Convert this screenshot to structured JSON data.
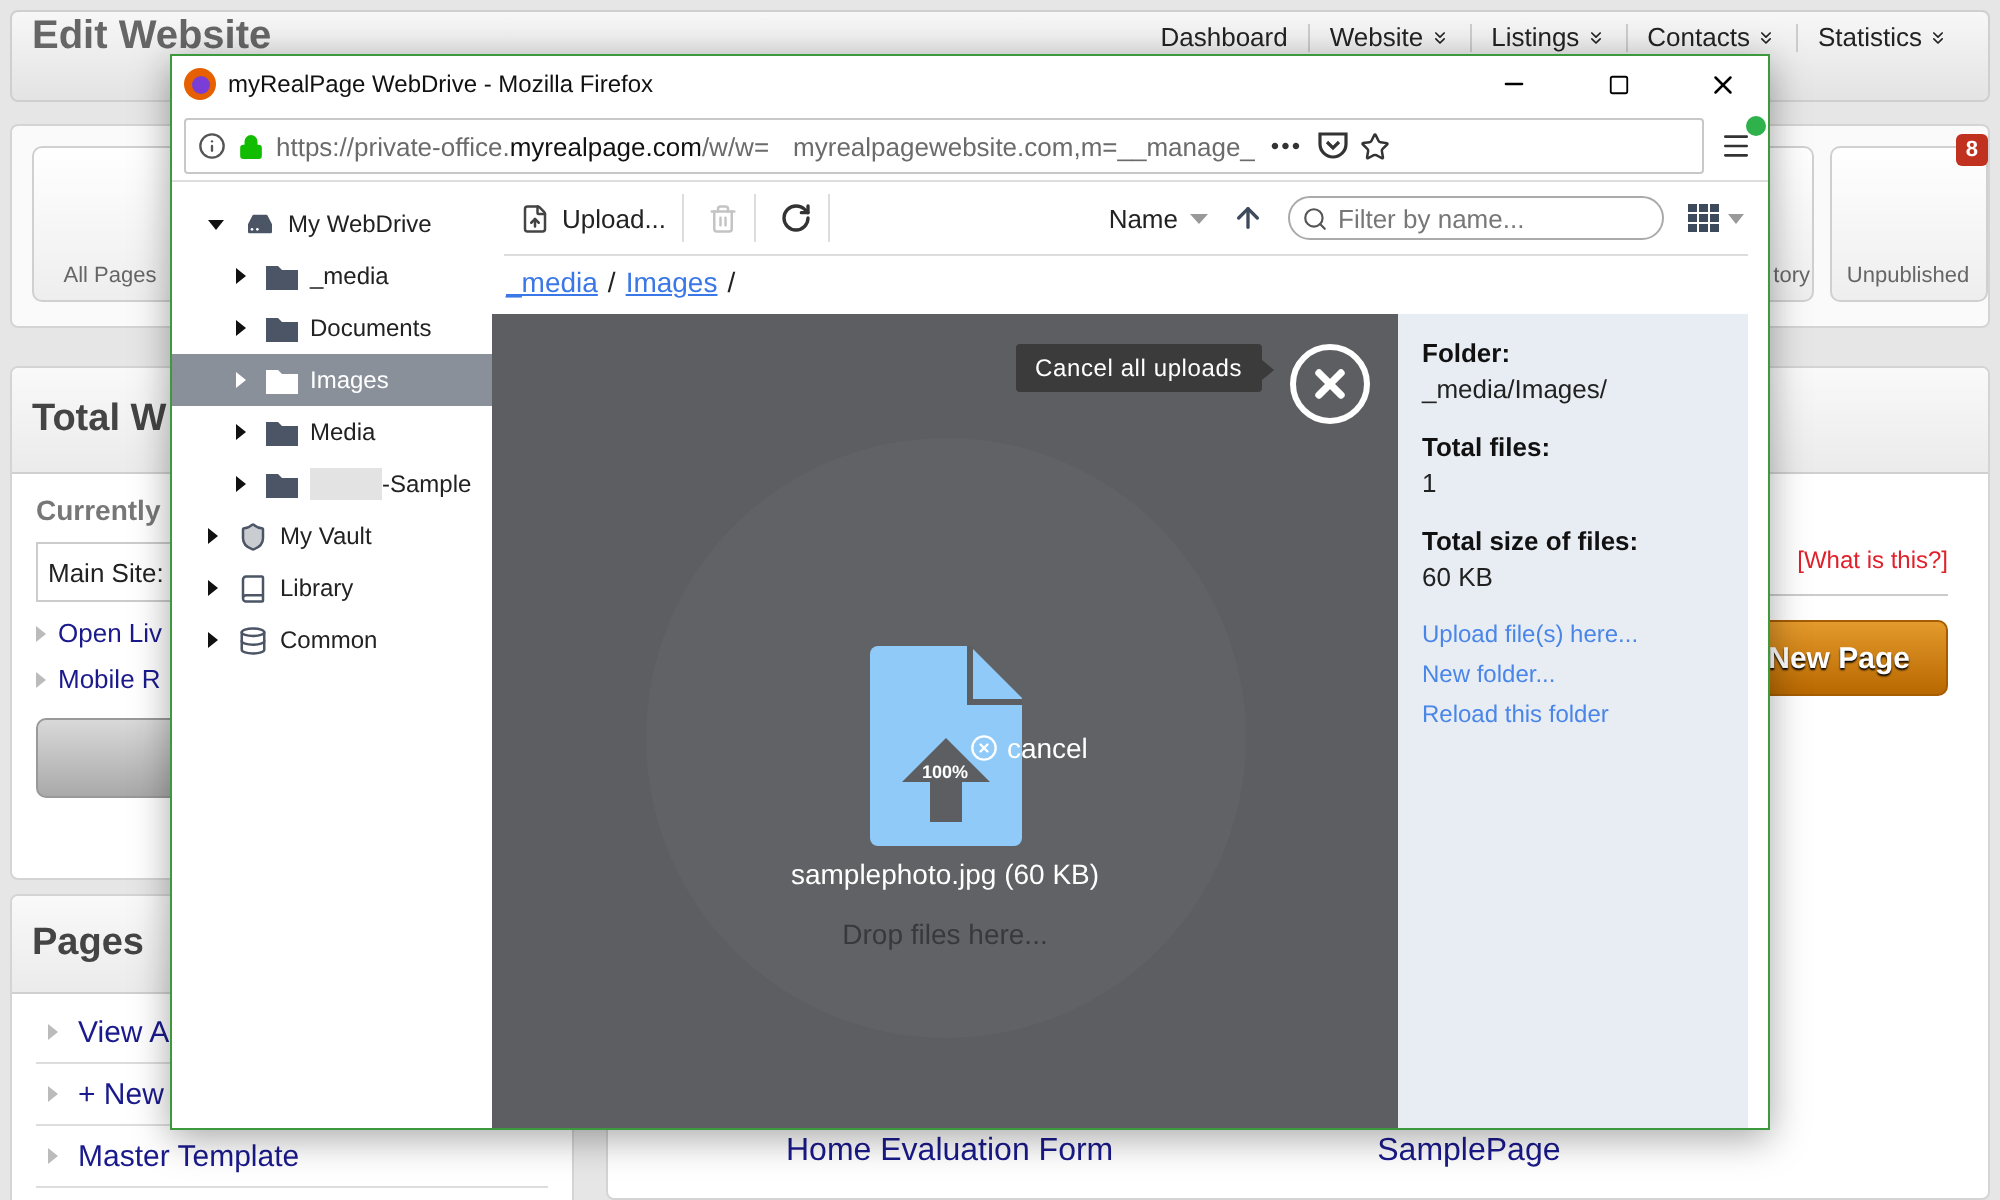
{
  "background_app": {
    "title": "Edit Website",
    "nav": [
      {
        "label": "Dashboard",
        "has_menu": false
      },
      {
        "label": "Website",
        "has_menu": true
      },
      {
        "label": "Listings",
        "has_menu": true
      },
      {
        "label": "Contacts",
        "has_menu": true
      },
      {
        "label": "Statistics",
        "has_menu": true
      }
    ],
    "tiles_left": [
      {
        "label": "All Pages"
      }
    ],
    "tiles_right": [
      {
        "label": "tory"
      },
      {
        "label": "Unpublished",
        "badge": "8"
      }
    ],
    "site_panel": {
      "heading": "Total W",
      "currently_label": "Currently",
      "site_select": "Main Site:",
      "links": [
        "Open Liv",
        "Mobile R"
      ]
    },
    "pages_panel": {
      "heading": "Pages",
      "links": [
        "View A",
        "+ New",
        "Master Template"
      ]
    },
    "main_panel": {
      "help_link": "[What is this?]",
      "new_page_button": "New Page",
      "pages": [
        "Home Evaluation Form",
        "SamplePage"
      ]
    }
  },
  "window": {
    "title": "myRealPage WebDrive - Mozilla Firefox",
    "url": {
      "prefix": "https://private-office.",
      "host": "myrealpage.com",
      "path": "/w/w=",
      "after_redaction": "myrealpagewebsite.com,m=__manage_"
    },
    "more_button": "•••",
    "update_available": true
  },
  "tree": [
    {
      "label": "My WebDrive",
      "kind": "drive",
      "expanded": true,
      "selected": false,
      "children": [
        {
          "label": "_media",
          "kind": "folder",
          "expanded": false,
          "selected": false
        },
        {
          "label": "Documents",
          "kind": "folder",
          "expanded": false,
          "selected": false
        },
        {
          "label": "Images",
          "kind": "folder",
          "expanded": false,
          "selected": true
        },
        {
          "label": "Media",
          "kind": "folder",
          "expanded": false,
          "selected": false
        },
        {
          "label": "-Sample",
          "kind": "folder",
          "expanded": false,
          "selected": false,
          "redacted": true
        }
      ]
    },
    {
      "label": "My Vault",
      "kind": "shield",
      "expanded": false,
      "selected": false
    },
    {
      "label": "Library",
      "kind": "book",
      "expanded": false,
      "selected": false
    },
    {
      "label": "Common",
      "kind": "database",
      "expanded": false,
      "selected": false
    }
  ],
  "toolbar": {
    "upload_button": "Upload...",
    "delete_disabled": true,
    "sort_field": "Name",
    "sort_ascending": true,
    "filter": {
      "placeholder": "Filter by name..."
    }
  },
  "breadcrumb": [
    {
      "label": "_media",
      "kind": "link"
    },
    {
      "label": "/",
      "kind": "separator"
    },
    {
      "label": "Images",
      "kind": "link"
    },
    {
      "label": "/",
      "kind": "separator"
    }
  ],
  "drop_zone": {
    "cancel_all_tooltip": "Cancel all uploads",
    "hint": "Drop files here...",
    "uploads": [
      {
        "name": "samplephoto.jpg (60 KB)",
        "percent": "100%",
        "cancel": "cancel"
      }
    ]
  },
  "info_panel": {
    "fields": [
      {
        "label": "Folder:",
        "value": "_media/Images/"
      },
      {
        "label": "Total files:",
        "value": "1"
      },
      {
        "label": "Total size of files:",
        "value": "60 KB"
      }
    ],
    "actions": [
      "Upload file(s) here...",
      "New folder...",
      "Reload this folder"
    ]
  }
}
